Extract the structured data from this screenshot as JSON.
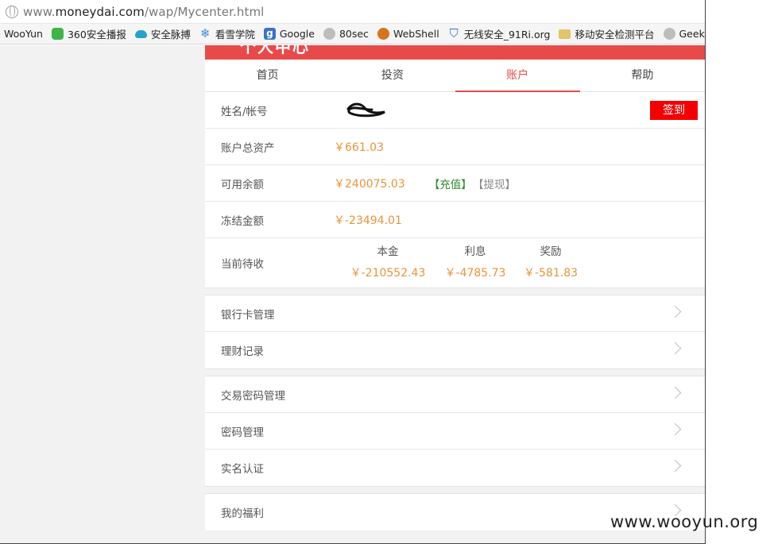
{
  "browser": {
    "url_prefix": "www.",
    "url_domain": "moneydai.com",
    "url_path": "/wap/Mycenter.html",
    "bookmarks": [
      "WooYun",
      "360安全播报",
      "安全脉搏",
      "看雪学院",
      "Google",
      "80sec",
      "WebShell",
      "无线安全_91Ri.org",
      "移动安全检测平台",
      "GeekG"
    ]
  },
  "header": {
    "title": "个人中心"
  },
  "tabs": [
    "首页",
    "投资",
    "账户",
    "帮助"
  ],
  "account": {
    "name_label": "姓名/帐号",
    "signin_label": "签到",
    "total_assets_label": "账户总资产",
    "total_assets_value": "￥661.03",
    "balance_label": "可用余额",
    "balance_value": "￥240075.03",
    "recharge_link": "【充值】",
    "withdraw_link": "【提现】",
    "frozen_label": "冻结金额",
    "frozen_value": "￥-23494.01",
    "pending_label": "当前待收",
    "pending": [
      {
        "head": "本金",
        "value": "￥-210552.43"
      },
      {
        "head": "利息",
        "value": "￥-4785.73"
      },
      {
        "head": "奖励",
        "value": "￥-581.83"
      }
    ]
  },
  "menu1": [
    "银行卡管理",
    "理财记录"
  ],
  "menu2": [
    "交易密码管理",
    "密码管理",
    "实名认证"
  ],
  "menu3": [
    "我的福利"
  ],
  "watermark": "www.wooyun.org"
}
